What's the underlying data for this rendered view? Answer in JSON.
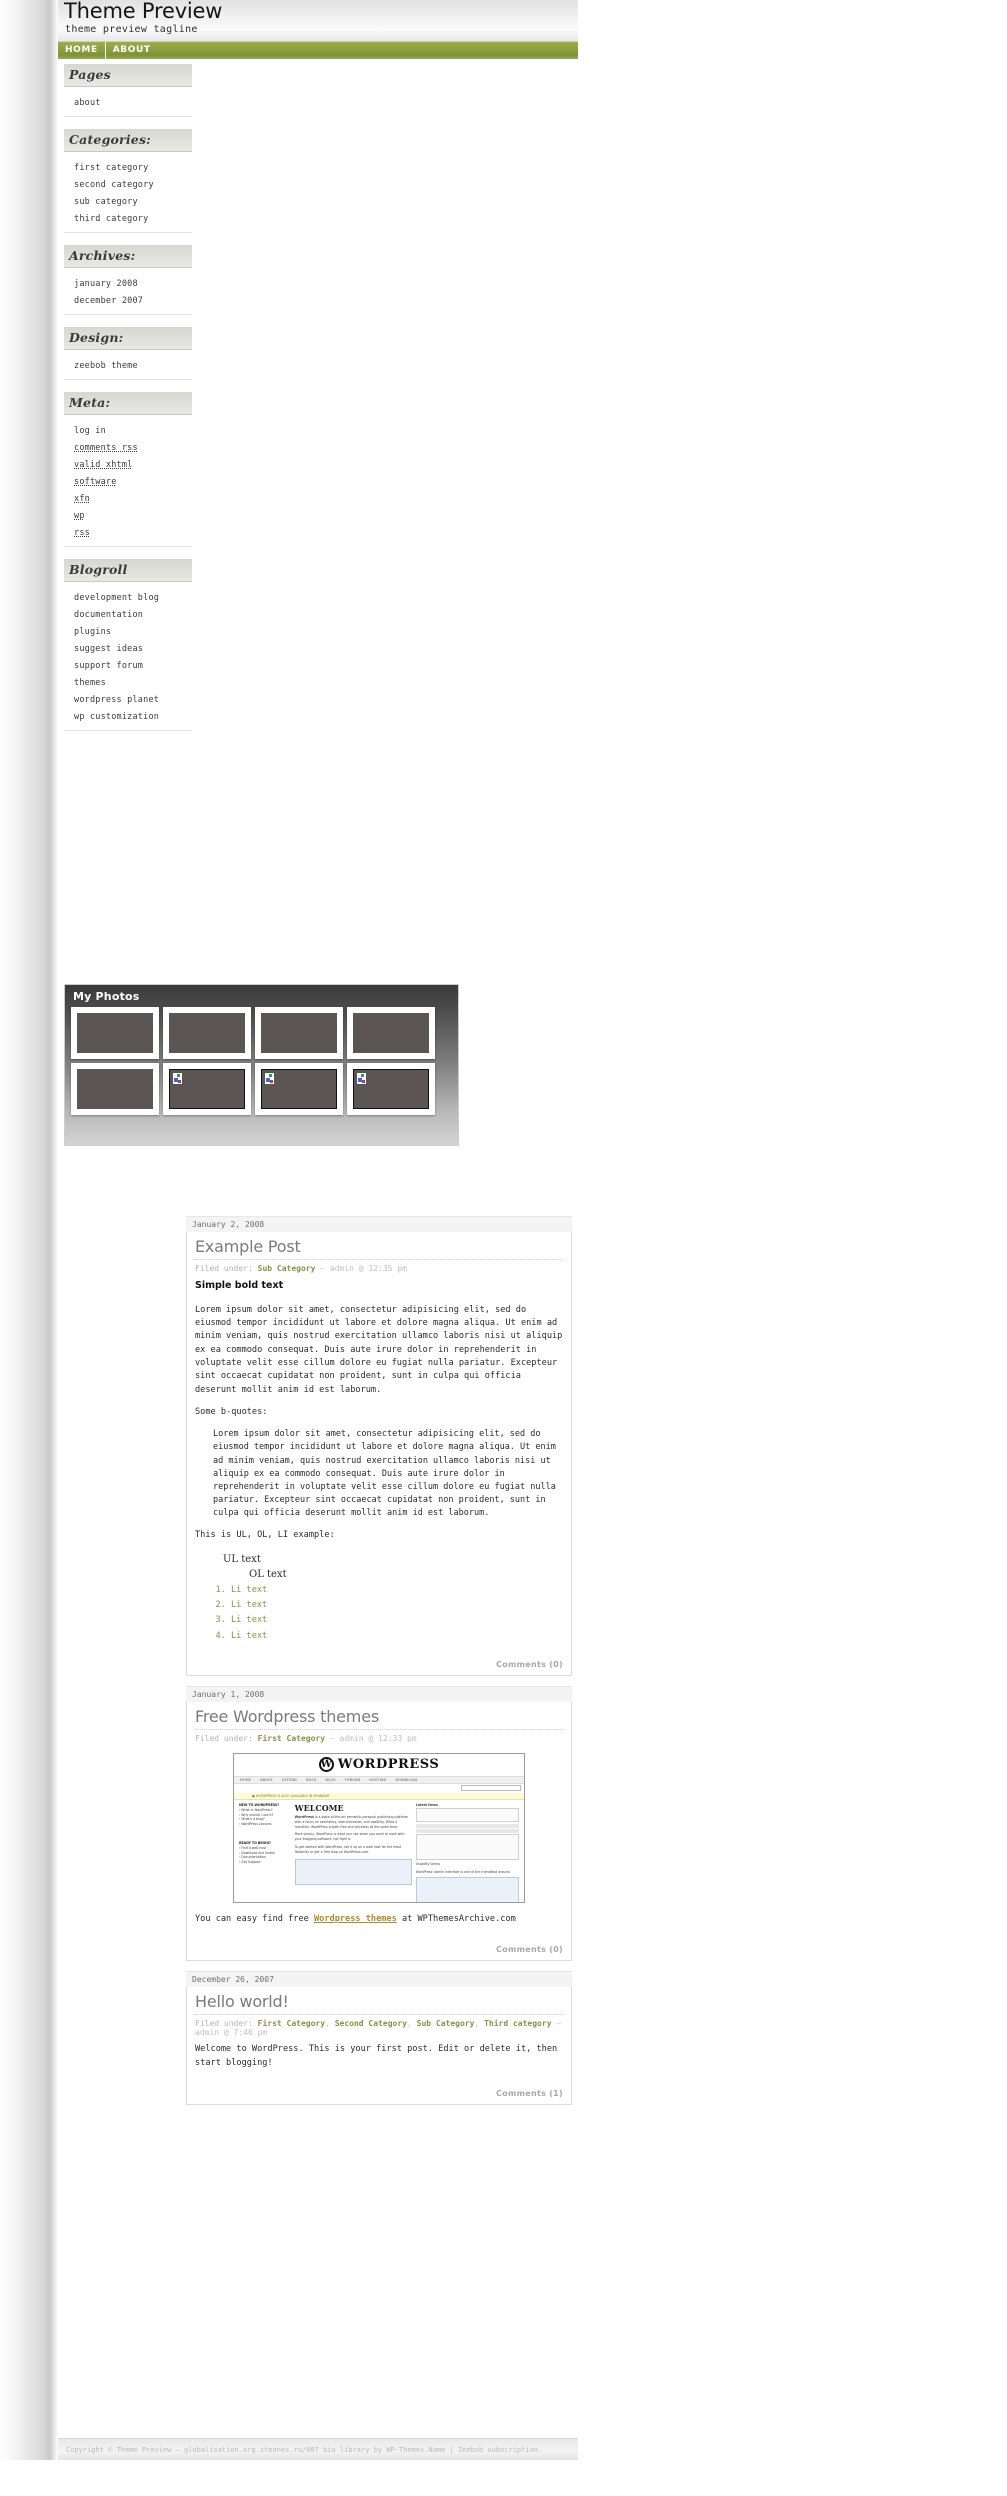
{
  "site": {
    "title": "Theme Preview",
    "tagline": "theme preview tagline"
  },
  "nav": {
    "items": [
      {
        "label": "HOME"
      },
      {
        "label": "ABOUT"
      }
    ]
  },
  "sidebar": {
    "widgets": [
      {
        "title": "Pages",
        "items": [
          {
            "label": "about"
          }
        ]
      },
      {
        "title": "Categories:",
        "items": [
          {
            "label": "first category"
          },
          {
            "label": "second category"
          },
          {
            "label": "sub category"
          },
          {
            "label": "third category"
          }
        ]
      },
      {
        "title": "Archives:",
        "items": [
          {
            "label": "january 2008"
          },
          {
            "label": "december 2007"
          }
        ]
      },
      {
        "title": "Design:",
        "items": [
          {
            "label": "zeebob theme"
          }
        ]
      },
      {
        "title": "Meta:",
        "items": [
          {
            "label": "log in"
          },
          {
            "label": "comments rss"
          },
          {
            "label": "valid xhtml"
          },
          {
            "label": "software"
          },
          {
            "label": "xfn"
          },
          {
            "label": "wp"
          },
          {
            "label": "rss"
          }
        ]
      },
      {
        "title": "Blogroll",
        "items": [
          {
            "label": "development blog"
          },
          {
            "label": "documentation"
          },
          {
            "label": "plugins"
          },
          {
            "label": "suggest ideas"
          },
          {
            "label": "support forum"
          },
          {
            "label": "themes"
          },
          {
            "label": "wordpress planet"
          },
          {
            "label": "wp customization"
          }
        ]
      }
    ]
  },
  "photos": {
    "title": "My Photos",
    "thumbs": [
      {
        "broken": false
      },
      {
        "broken": false
      },
      {
        "broken": false
      },
      {
        "broken": false
      },
      {
        "broken": false
      },
      {
        "broken": true
      },
      {
        "broken": true
      },
      {
        "broken": true
      }
    ]
  },
  "posts": [
    {
      "date": "January 2, 2008",
      "title": "Example Post",
      "filed_label": "Filed under:",
      "categories": [
        "Sub Category"
      ],
      "author_line": "— admin @ 12:35 pm",
      "bold_line": "Simple bold text",
      "para1": "Lorem ipsum dolor sit amet, consectetur adipisicing elit, sed do eiusmod tempor incididunt ut labore et dolore magna aliqua. Ut enim ad minim veniam, quis nostrud exercitation ullamco laboris nisi ut aliquip ex ea commodo consequat. Duis aute irure dolor in reprehenderit in voluptate velit esse cillum dolore eu fugiat nulla pariatur. Excepteur sint occaecat cupidatat non proident, sunt in culpa qui officia deserunt mollit anim id est laborum.",
      "para2": "Some b-quotes:",
      "blockquote": "Lorem ipsum dolor sit amet, consectetur adipisicing elit, sed do eiusmod tempor incididunt ut labore et dolore magna aliqua. Ut enim ad minim veniam, quis nostrud exercitation ullamco laboris nisi ut aliquip ex ea commodo consequat. Duis aute irure dolor in reprehenderit in voluptate velit esse cillum dolore eu fugiat nulla pariatur. Excepteur sint occaecat cupidatat non proident, sunt in culpa qui officia deserunt mollit anim id est laborum.",
      "para3": "This is UL, OL, LI example:",
      "ul_text": "UL text",
      "ol_text": "OL text",
      "li_items": [
        "Li text",
        "Li text",
        "Li text",
        "Li text"
      ],
      "comments": "Comments (0)"
    },
    {
      "date": "January 1, 2008",
      "title": "Free Wordpress themes",
      "filed_label": "Filed under:",
      "categories": [
        "First Category"
      ],
      "author_line": "— admin @ 12:33 pm",
      "closing_prefix": "You can easy find free ",
      "closing_link": "Wordpress themes",
      "closing_suffix": " at WPThemesArchive.com",
      "comments": "Comments (0)"
    },
    {
      "date": "December 26, 2007",
      "title": "Hello world!",
      "filed_label": "Filed under:",
      "categories": [
        "First Category",
        "Second Category",
        "Sub Category",
        "Third category"
      ],
      "author_line": "— admin @ 7:46 pm",
      "body": "Welcome to WordPress. This is your first post. Edit or delete it, then start blogging!",
      "comments": "Comments (1)"
    }
  ],
  "wp_shot": {
    "brand": "WORDPRESS",
    "nav": [
      "HOME",
      "ABOUT",
      "EXTEND",
      "DOCS",
      "BLOG",
      "FORUMS",
      "HOSTING",
      "DOWNLOAD"
    ],
    "notice": "● WORDPRESS IS ALSO AVAILABLE IN MYANMAR",
    "search_label": "SEARCH",
    "welcome": "WELCOME",
    "left_h1": "NEW TO WORDPRESS?",
    "left_l1": "› What is WordPress?",
    "left_l2": "› Why should I use it?",
    "left_l3": "› What's a blog?",
    "left_l4": "› WordPress Lessons",
    "left_h2": "READY TO BEGIN?",
    "left_l5": "› Find a web host",
    "left_l6": "› Download and Install",
    "left_l7": "› Documentation",
    "left_l8": "› Get Support",
    "c_h": "WordPress",
    "c_p1": "is a state-of-the-art semantic personal publishing platform with a focus on aesthetics, web standards, and usability. What a mouthful. WordPress is both free and priceless at the same time.",
    "c_p2": "More simply, WordPress is what you use when you want to work with your blogging software, not fight it.",
    "c_p3": "To get started with WordPress, set it up on a web host for the most flexibility or get a free blog on WordPress.com.",
    "r_cap1": "Latest News",
    "r_cap2": "WordPress' admin interface is one of the friendliest around.",
    "r_cap3": "Usability Demo"
  },
  "footer": {
    "text": "Copyright © Theme Preview — globalisation.org.steones.ru/007 bio library by WP-Themes.Name | Zeebob subscription."
  }
}
